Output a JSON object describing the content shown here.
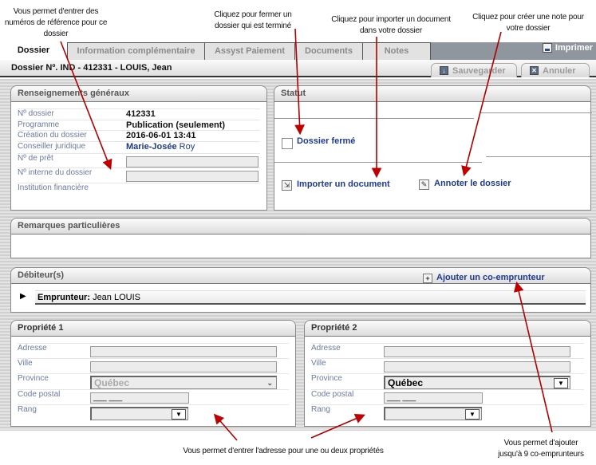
{
  "callouts": {
    "reference_numbers": "Vous permet d'entrer des numéros de référence pour ce dossier",
    "close_file": "Cliquez pour fermer un dossier qui est terminé",
    "import_document": "Cliquez pour importer un document dans votre dossier",
    "create_note": "Cliquez pour créer une note pour votre dossier",
    "property_address": "Vous permet d'entrer l'adresse pour une ou deux propriétés",
    "co_borrowers": "Vous permet d'ajouter jusqu'à 9 co-emprunteurs"
  },
  "tabs": [
    {
      "label": "Dossier",
      "active": true
    },
    {
      "label": "Information complémentaire",
      "active": false
    },
    {
      "label": "Assyst Paiement",
      "active": false
    },
    {
      "label": "Documents",
      "active": false
    },
    {
      "label": "Notes",
      "active": false
    }
  ],
  "toolbar": {
    "print_label": "Imprimer",
    "save_label": "Sauvegarder",
    "cancel_label": "Annuler"
  },
  "file_header": {
    "prefix": "Dossier Nº. ",
    "value": "IND - 412331 - LOUIS, Jean"
  },
  "general_info": {
    "title": "Renseignements généraux",
    "rows": [
      {
        "label": "Nº dossier",
        "value": "412331"
      },
      {
        "label": "Programme",
        "value": "Publication (seulement)"
      },
      {
        "label": "Création du dossier",
        "value": "2016-06-01 13:41"
      },
      {
        "label": "Conseiller juridique",
        "value_bold": "Marie-Josée",
        "value_rest": " Roy"
      },
      {
        "label": "Nº de prêt",
        "value": ""
      },
      {
        "label": "Nº interne du dossier",
        "value": ""
      },
      {
        "label": "Institution financière",
        "value": ""
      }
    ]
  },
  "status": {
    "title": "Statut",
    "closed_label": "Dossier fermé",
    "closed_checked": false,
    "import_label": "Importer un document",
    "annotate_label": "Annoter le dossier"
  },
  "remarks": {
    "title": "Remarques particulières"
  },
  "debtors": {
    "title": "Débiteur(s)",
    "add_label": "Ajouter un co-emprunteur",
    "borrower_label": "Emprunteur:",
    "borrower_name": "Jean LOUIS"
  },
  "property1": {
    "title": "Propriété 1",
    "labels": [
      "Adresse",
      "Ville",
      "Province",
      "Code postal",
      "Rang"
    ],
    "address": "",
    "city": "",
    "province": "Québec",
    "postal_code": "___ ___",
    "rank": ""
  },
  "property2": {
    "title": "Propriété 2",
    "labels": [
      "Adresse",
      "Ville",
      "Province",
      "Code postal",
      "Rang"
    ],
    "address": "",
    "city": "",
    "province": "Québec",
    "postal_code": "___ ___",
    "rank": ""
  }
}
